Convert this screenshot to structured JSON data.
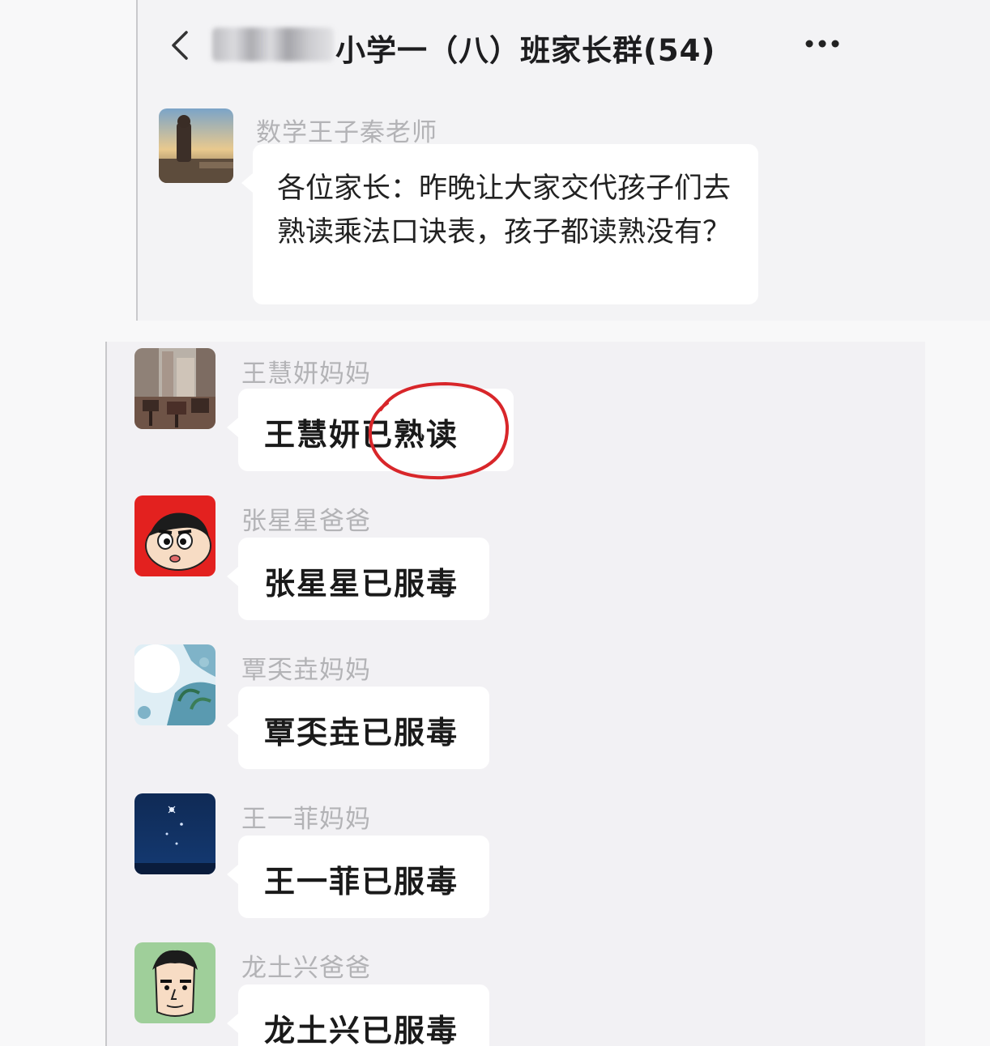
{
  "chat": {
    "title": "小学一（八）班家长群(54)"
  },
  "messages": [
    {
      "sender": "数学王子秦老师",
      "text": "各位家长：昨晚让大家交代孩子们去熟读乘法口诀表，孩子都读熟没有？",
      "avatar_icon": "landscape-photo"
    },
    {
      "sender": "王慧妍妈妈",
      "text": "王慧妍已熟读",
      "avatar_icon": "street-photo"
    },
    {
      "sender": "张星星爸爸",
      "text": "张星星已服毒",
      "avatar_icon": "cartoon-boy-red"
    },
    {
      "sender": "覃奀垚妈妈",
      "text": "覃奀垚已服毒",
      "avatar_icon": "sky-plant-photo"
    },
    {
      "sender": "王一菲妈妈",
      "text": "王一菲已服毒",
      "avatar_icon": "night-sky-photo"
    },
    {
      "sender": "龙土兴爸爸",
      "text": "龙土兴已服毒",
      "avatar_icon": "cartoon-man-green"
    }
  ],
  "colors": {
    "highlight_circle": "#d8262a",
    "bubble": "#ffffff",
    "sender_text": "#b3b3b6"
  }
}
